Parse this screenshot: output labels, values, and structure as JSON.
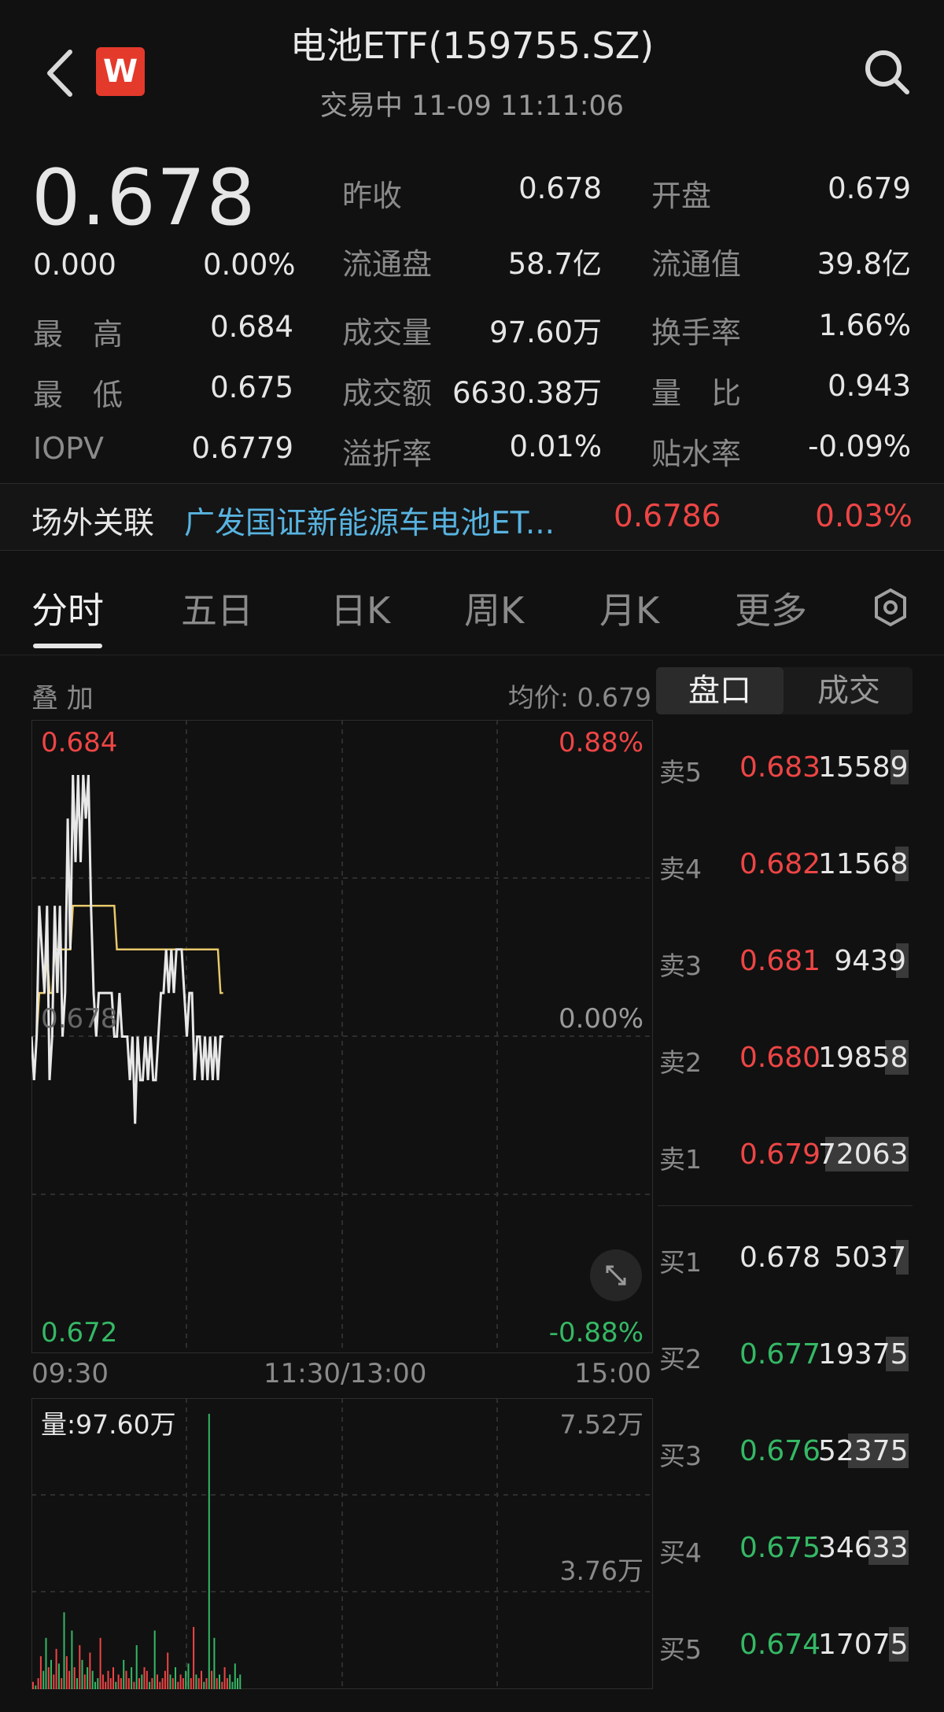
{
  "header": {
    "title": "电池ETF(159755.SZ)",
    "subtitle": "交易中 11-09 11:11:06",
    "logo_text": "W"
  },
  "quote": {
    "price": "0.678",
    "change": "0.000",
    "change_pct": "0.00%",
    "high_label": "最　高",
    "high": "0.684",
    "low_label": "最　低",
    "low": "0.675",
    "iopv_label": "IOPV",
    "iopv": "0.6779",
    "col2": [
      {
        "label": "昨收",
        "value": "0.678"
      },
      {
        "label": "流通盘",
        "value": "58.7亿"
      },
      {
        "label": "成交量",
        "value": "97.60万"
      },
      {
        "label": "成交额",
        "value": "6630.38万"
      },
      {
        "label": "溢折率",
        "value": "0.01%"
      }
    ],
    "col3": [
      {
        "label": "开盘",
        "value": "0.679"
      },
      {
        "label": "流通值",
        "value": "39.8亿"
      },
      {
        "label": "换手率",
        "value": "1.66%"
      },
      {
        "label": "量　比",
        "value": "0.943"
      },
      {
        "label": "贴水率",
        "value": "-0.09%"
      }
    ]
  },
  "offsite": {
    "label": "场外关联",
    "fund_name": "广发国证新能源车电池ET...",
    "value": "0.6786",
    "pct": "0.03%"
  },
  "tabs": [
    "分时",
    "五日",
    "日K",
    "周K",
    "月K",
    "更多"
  ],
  "chart": {
    "overlay_label": "叠 加",
    "avg_price_label": "均价: 0.679",
    "y_max": "0.684",
    "y_mid": "0.678",
    "y_min": "0.672",
    "pct_max": "0.88%",
    "pct_mid": "0.00%",
    "pct_min": "-0.88%",
    "x_labels": [
      "09:30",
      "11:30/13:00",
      "15:00"
    ],
    "volume_label": "量:97.60万",
    "vol_max": "7.52万",
    "vol_mid": "3.76万",
    "colors": {
      "price": "#e8e8e8",
      "avg": "#e8c86a",
      "up": "#ee4545",
      "down": "#35b865"
    }
  },
  "chart_data": {
    "type": "line",
    "ylim": [
      0.672,
      0.684
    ],
    "series": [
      {
        "values": [
          0.678,
          0.677,
          0.678,
          0.681,
          0.68,
          0.679,
          0.681,
          0.677,
          0.678,
          0.681,
          0.679,
          0.681,
          0.678,
          0.679,
          0.683,
          0.68,
          0.684,
          0.682,
          0.684,
          0.682,
          0.684,
          0.683,
          0.684,
          0.681,
          0.679,
          0.678,
          0.679,
          0.679,
          0.679,
          0.679,
          0.679,
          0.679,
          0.678,
          0.678,
          0.679,
          0.678,
          0.678,
          0.678,
          0.677,
          0.678,
          0.676,
          0.678,
          0.677,
          0.677,
          0.678,
          0.677,
          0.678,
          0.677,
          0.677,
          0.678,
          0.679,
          0.679,
          0.68,
          0.679,
          0.68,
          0.679,
          0.68,
          0.68,
          0.68,
          0.679,
          0.678,
          0.679,
          0.679,
          0.677,
          0.678,
          0.678,
          0.677,
          0.678,
          0.677,
          0.678,
          0.677,
          0.678,
          0.677,
          0.678,
          0.678
        ]
      },
      {
        "values": [
          0.678,
          0.677,
          0.678,
          0.679,
          0.679,
          0.679,
          0.68,
          0.679,
          0.679,
          0.68,
          0.68,
          0.68,
          0.68,
          0.68,
          0.68,
          0.68,
          0.681,
          0.681,
          0.681,
          0.681,
          0.681,
          0.681,
          0.681,
          0.681,
          0.681,
          0.681,
          0.681,
          0.681,
          0.681,
          0.681,
          0.681,
          0.681,
          0.681,
          0.68,
          0.68,
          0.68,
          0.68,
          0.68,
          0.68,
          0.68,
          0.68,
          0.68,
          0.68,
          0.68,
          0.68,
          0.68,
          0.68,
          0.68,
          0.68,
          0.68,
          0.68,
          0.68,
          0.68,
          0.68,
          0.68,
          0.68,
          0.68,
          0.68,
          0.68,
          0.68,
          0.68,
          0.68,
          0.68,
          0.68,
          0.68,
          0.68,
          0.68,
          0.68,
          0.68,
          0.68,
          0.68,
          0.68,
          0.68,
          0.679,
          0.679
        ]
      }
    ],
    "volume": [
      0.2,
      0.1,
      0.3,
      0.9,
      0.5,
      1.4,
      0.6,
      0.8,
      0.4,
      1.1,
      0.7,
      0.3,
      2.1,
      0.9,
      0.5,
      1.6,
      0.6,
      0.3,
      1.2,
      0.8,
      0.4,
      0.6,
      1.0,
      0.5,
      0.2,
      0.3,
      1.4,
      0.4,
      0.2,
      0.5,
      0.3,
      0.6,
      0.2,
      0.4,
      0.3,
      0.8,
      0.5,
      0.3,
      0.6,
      0.2,
      1.2,
      0.3,
      0.4,
      0.6,
      0.5,
      0.2,
      0.3,
      1.6,
      0.4,
      0.2,
      0.3,
      0.5,
      1.0,
      0.4,
      0.3,
      0.6,
      0.2,
      0.4,
      0.3,
      0.5,
      0.7,
      0.3,
      1.7,
      0.4,
      0.3,
      0.5,
      0.2,
      0.3,
      7.52,
      0.5,
      1.4,
      0.3,
      0.4,
      0.2,
      0.6,
      0.3,
      0.4,
      0.2,
      0.7,
      0.3,
      0.4
    ]
  },
  "orderbook": {
    "tab_pankou": "盘口",
    "tab_chengjiao": "成交",
    "asks": [
      {
        "label": "卖5",
        "price": "0.683",
        "vol": "15589",
        "depth": 0.22
      },
      {
        "label": "卖4",
        "price": "0.682",
        "vol": "11568",
        "depth": 0.16
      },
      {
        "label": "卖3",
        "price": "0.681",
        "vol": "9439",
        "depth": 0.13
      },
      {
        "label": "卖2",
        "price": "0.680",
        "vol": "19858",
        "depth": 0.28
      },
      {
        "label": "卖1",
        "price": "0.679",
        "vol": "72063",
        "depth": 1.0
      }
    ],
    "bids": [
      {
        "label": "买1",
        "price": "0.678",
        "vol": "5037",
        "depth": 0.07
      },
      {
        "label": "买2",
        "price": "0.677",
        "vol": "19375",
        "depth": 0.27
      },
      {
        "label": "买3",
        "price": "0.676",
        "vol": "52375",
        "depth": 0.73
      },
      {
        "label": "买4",
        "price": "0.675",
        "vol": "34633",
        "depth": 0.48
      },
      {
        "label": "买5",
        "price": "0.674",
        "vol": "17075",
        "depth": 0.24
      }
    ]
  }
}
